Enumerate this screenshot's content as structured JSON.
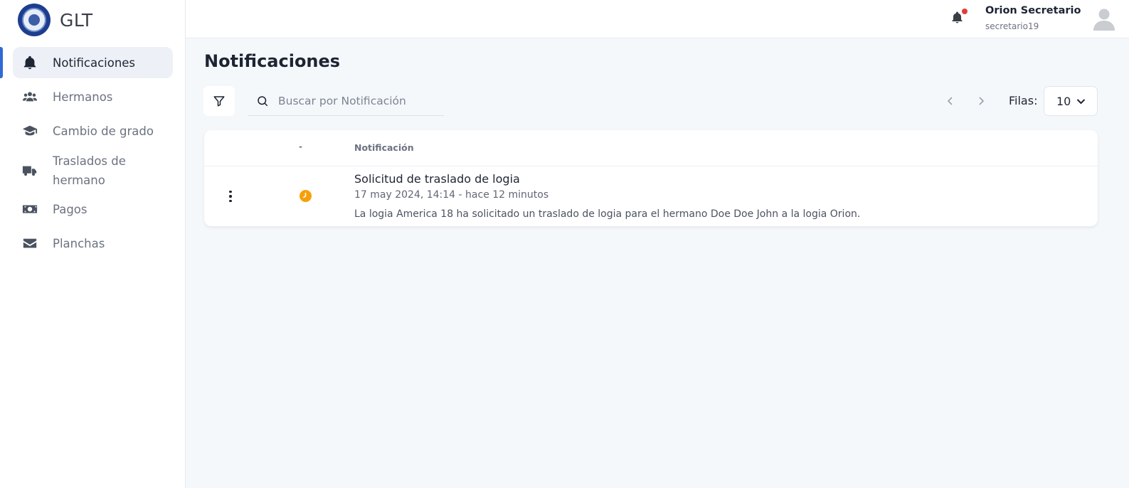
{
  "brand": {
    "name": "GLT",
    "logo_icon": "lodge-seal-icon"
  },
  "sidebar": {
    "items": [
      {
        "label": "Notificaciones",
        "icon": "bell-icon",
        "active": true
      },
      {
        "label": "Hermanos",
        "icon": "users-icon"
      },
      {
        "label": "Cambio de grado",
        "icon": "graduation-cap-icon"
      },
      {
        "label": "Traslados de hermano",
        "icon": "truck-icon"
      },
      {
        "label": "Pagos",
        "icon": "money-icon"
      },
      {
        "label": "Planchas",
        "icon": "envelope-icon"
      }
    ]
  },
  "header": {
    "user_name": "Orion Secretario",
    "user_handle": "secretario19",
    "has_unread": true
  },
  "main": {
    "title": "Notificaciones",
    "search_placeholder": "Buscar por Notificación",
    "rows_label": "Filas:",
    "rows_value": "10",
    "table": {
      "headers": [
        "-",
        "Notificación"
      ],
      "rows": [
        {
          "status": "pending",
          "title": "Solicitud de traslado de logia",
          "date": "17 may 2024, 14:14 - hace 12 minutos",
          "description": "La logia America 18 ha solicitado un traslado de logia para el hermano Doe Doe John a la logia Orion."
        }
      ]
    }
  },
  "colors": {
    "accent": "#3169d6",
    "pending": "#f5a00b",
    "notification_dot": "#e03e3e"
  }
}
